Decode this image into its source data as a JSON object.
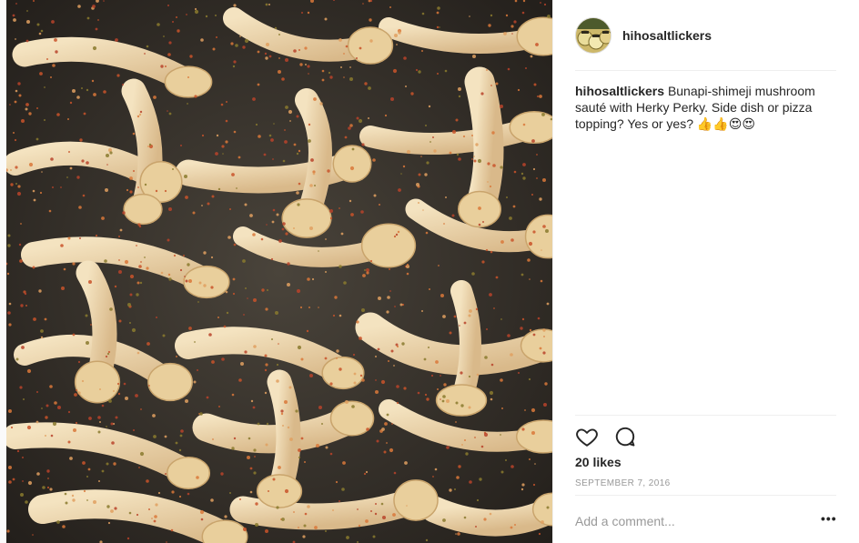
{
  "post": {
    "image_alt": "Bunapi-shimeji mushroom sauté with Herky Perky",
    "username": "hihosaltlickers",
    "caption": {
      "username": "hihosaltlickers",
      "text": "Bunapi-shimeji mushroom sauté with Herky Perky. Side dish or pizza topping? Yes or yes?",
      "emoji": "👍👍😍😍"
    },
    "likes": "20 likes",
    "date": "September 7, 2016",
    "comment_placeholder": "Add a comment...",
    "more_label": "•••"
  },
  "icons": {
    "like": "heart-icon",
    "comment": "comment-icon",
    "more": "more-options-icon"
  },
  "colors": {
    "text": "#262626",
    "muted": "#999999",
    "divider": "#efefef"
  }
}
